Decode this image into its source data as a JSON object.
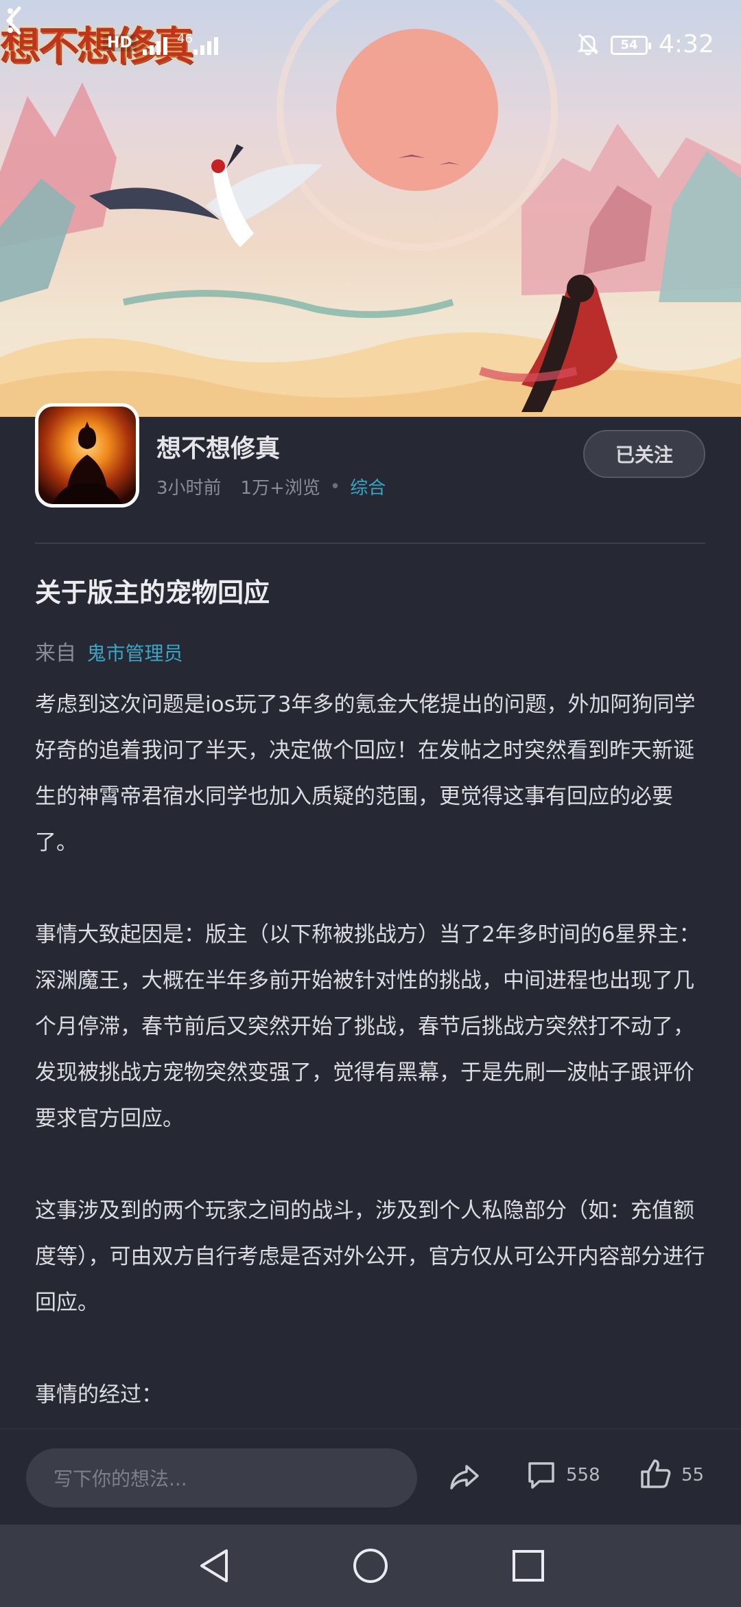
{
  "status_bar": {
    "game_logo_text": "想不想修真",
    "hd_badge": "HD",
    "network": "46",
    "battery": "54",
    "time": "4:32"
  },
  "post": {
    "author": {
      "name": "想不想修真",
      "posted_ago": "3小时前",
      "views": "1万+浏览",
      "category": "综合"
    },
    "follow_label": "已关注",
    "title": "关于版主的宠物回应",
    "from_prefix": "来自",
    "from_source": "鬼市管理员",
    "paragraphs": [
      "考虑到这次问题是ios玩了3年多的氪金大佬提出的问题，外加阿狗同学好奇的追着我问了半天，决定做个回应！在发帖之时突然看到昨天新诞生的神霄帝君宿水同学也加入质疑的范围，更觉得这事有回应的必要了。",
      "事情大致起因是：版主（以下称被挑战方）当了2年多时间的6星界主：深渊魔王，大概在半年多前开始被针对性的挑战，中间进程也出现了几个月停滞，春节前后又突然开始了挑战，春节后挑战方突然打不动了，发现被挑战方宠物突然变强了，觉得有黑幕，于是先刷一波帖子跟评价要求官方回应。",
      "这事涉及到的两个玩家之间的战斗，涉及到个人私隐部分（如：充值额度等），可由双方自行考虑是否对外公开，官方仅从可公开内容部分进行回应。",
      "事情的经过："
    ]
  },
  "action_bar": {
    "input_placeholder": "写下你的想法...",
    "comment_count": "558",
    "like_count": "55"
  },
  "icons": {
    "back": "back-arrow-icon",
    "more": "more-vertical-icon",
    "share": "share-icon",
    "comment": "comment-icon",
    "like": "thumbs-up-icon",
    "mute": "bell-off-icon"
  }
}
